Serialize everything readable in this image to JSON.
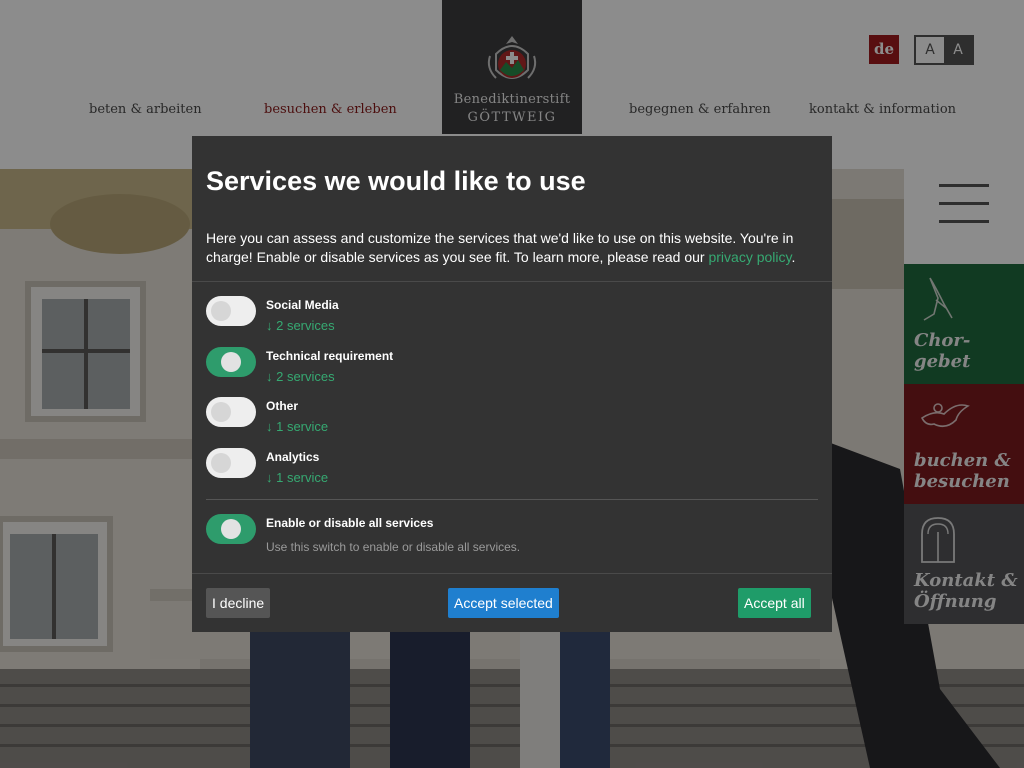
{
  "header": {
    "nav": [
      {
        "label": "beten & arbeiten"
      },
      {
        "label": "besuchen & erleben"
      },
      {
        "label": "begegnen & erfahren"
      },
      {
        "label": "kontakt & information"
      }
    ],
    "logo": {
      "line1": "Benediktinerstift",
      "line2": "GÖTTWEIG"
    },
    "lang": "de",
    "font_size_options": [
      "A",
      "A"
    ]
  },
  "side_tiles": [
    {
      "label_line1": "Chor-",
      "label_line2": "gebet",
      "icon": "praying-hands-icon"
    },
    {
      "label_line1": "buchen &",
      "label_line2": "besuchen",
      "icon": "angel-icon"
    },
    {
      "label_line1": "Kontakt &",
      "label_line2": "Öffnung",
      "icon": "door-icon"
    }
  ],
  "consent": {
    "title": "Services we would like to use",
    "description": "Here you can assess and customize the services that we'd like to use on this website. You're in charge! Enable or disable services as you see fit. To learn more, please read our ",
    "privacy_link": "privacy policy",
    "description_end": ".",
    "services": [
      {
        "name": "Social Media",
        "count": "↓ 2 services",
        "enabled": false
      },
      {
        "name": "Technical requirement",
        "count": "↓ 2 services",
        "enabled": true
      },
      {
        "name": "Other",
        "count": "↓ 1 service",
        "enabled": false
      },
      {
        "name": "Analytics",
        "count": "↓ 1 service",
        "enabled": false
      }
    ],
    "all_toggle": {
      "name": "Enable or disable all services",
      "description": "Use this switch to enable or disable all services.",
      "enabled": true
    },
    "buttons": {
      "decline": "I decline",
      "accept_selected": "Accept selected",
      "accept_all": "Accept all"
    }
  },
  "colors": {
    "accent_red": "#a01a1e",
    "accent_green": "#1f9c69",
    "accent_blue": "#1f7fcf",
    "modal_bg": "#333333"
  }
}
